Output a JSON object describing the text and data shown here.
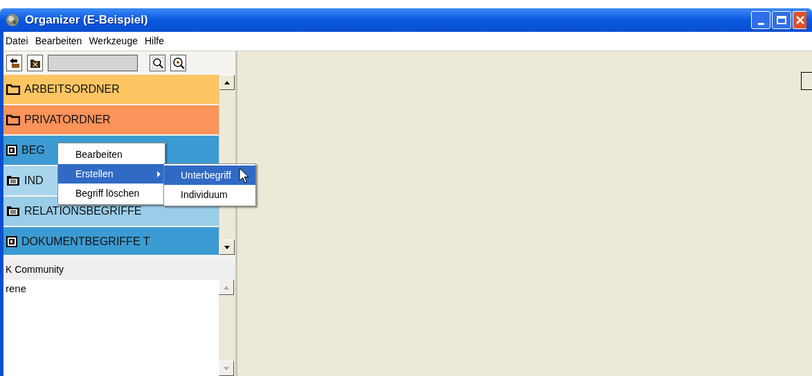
{
  "window": {
    "title": "Organizer (E-Beispiel)"
  },
  "menu": [
    "Datei",
    "Bearbeiten",
    "Werkzeuge",
    "Hilfe"
  ],
  "tree": [
    {
      "label": "ARBEITSORDNER",
      "kind": "folder",
      "color": "#fec562"
    },
    {
      "label": "PRIVATORDNER",
      "kind": "folder",
      "color": "#fb935a"
    },
    {
      "label": "BEG",
      "kind": "concept",
      "color": "#3b9bd2"
    },
    {
      "label": "IND",
      "kind": "list-folder",
      "color": "#a9d5ec"
    },
    {
      "label": "RELATIONSBEGRIFFE",
      "kind": "list-folder",
      "color": "#9acde8"
    },
    {
      "label": "DOKUMENTBEGRIFFE T",
      "kind": "concept",
      "color": "#3b9bd2"
    }
  ],
  "context_menu": [
    {
      "label": "Bearbeiten",
      "selected": false,
      "submenu": false
    },
    {
      "label": "Erstellen",
      "selected": true,
      "submenu": true
    },
    {
      "label": "Begriff löschen",
      "selected": false,
      "submenu": false
    }
  ],
  "submenu": [
    {
      "label": "Unterbegriff",
      "selected": true
    },
    {
      "label": "Individuum",
      "selected": false
    }
  ],
  "community": {
    "header": "K Community",
    "items": [
      "rene"
    ]
  }
}
